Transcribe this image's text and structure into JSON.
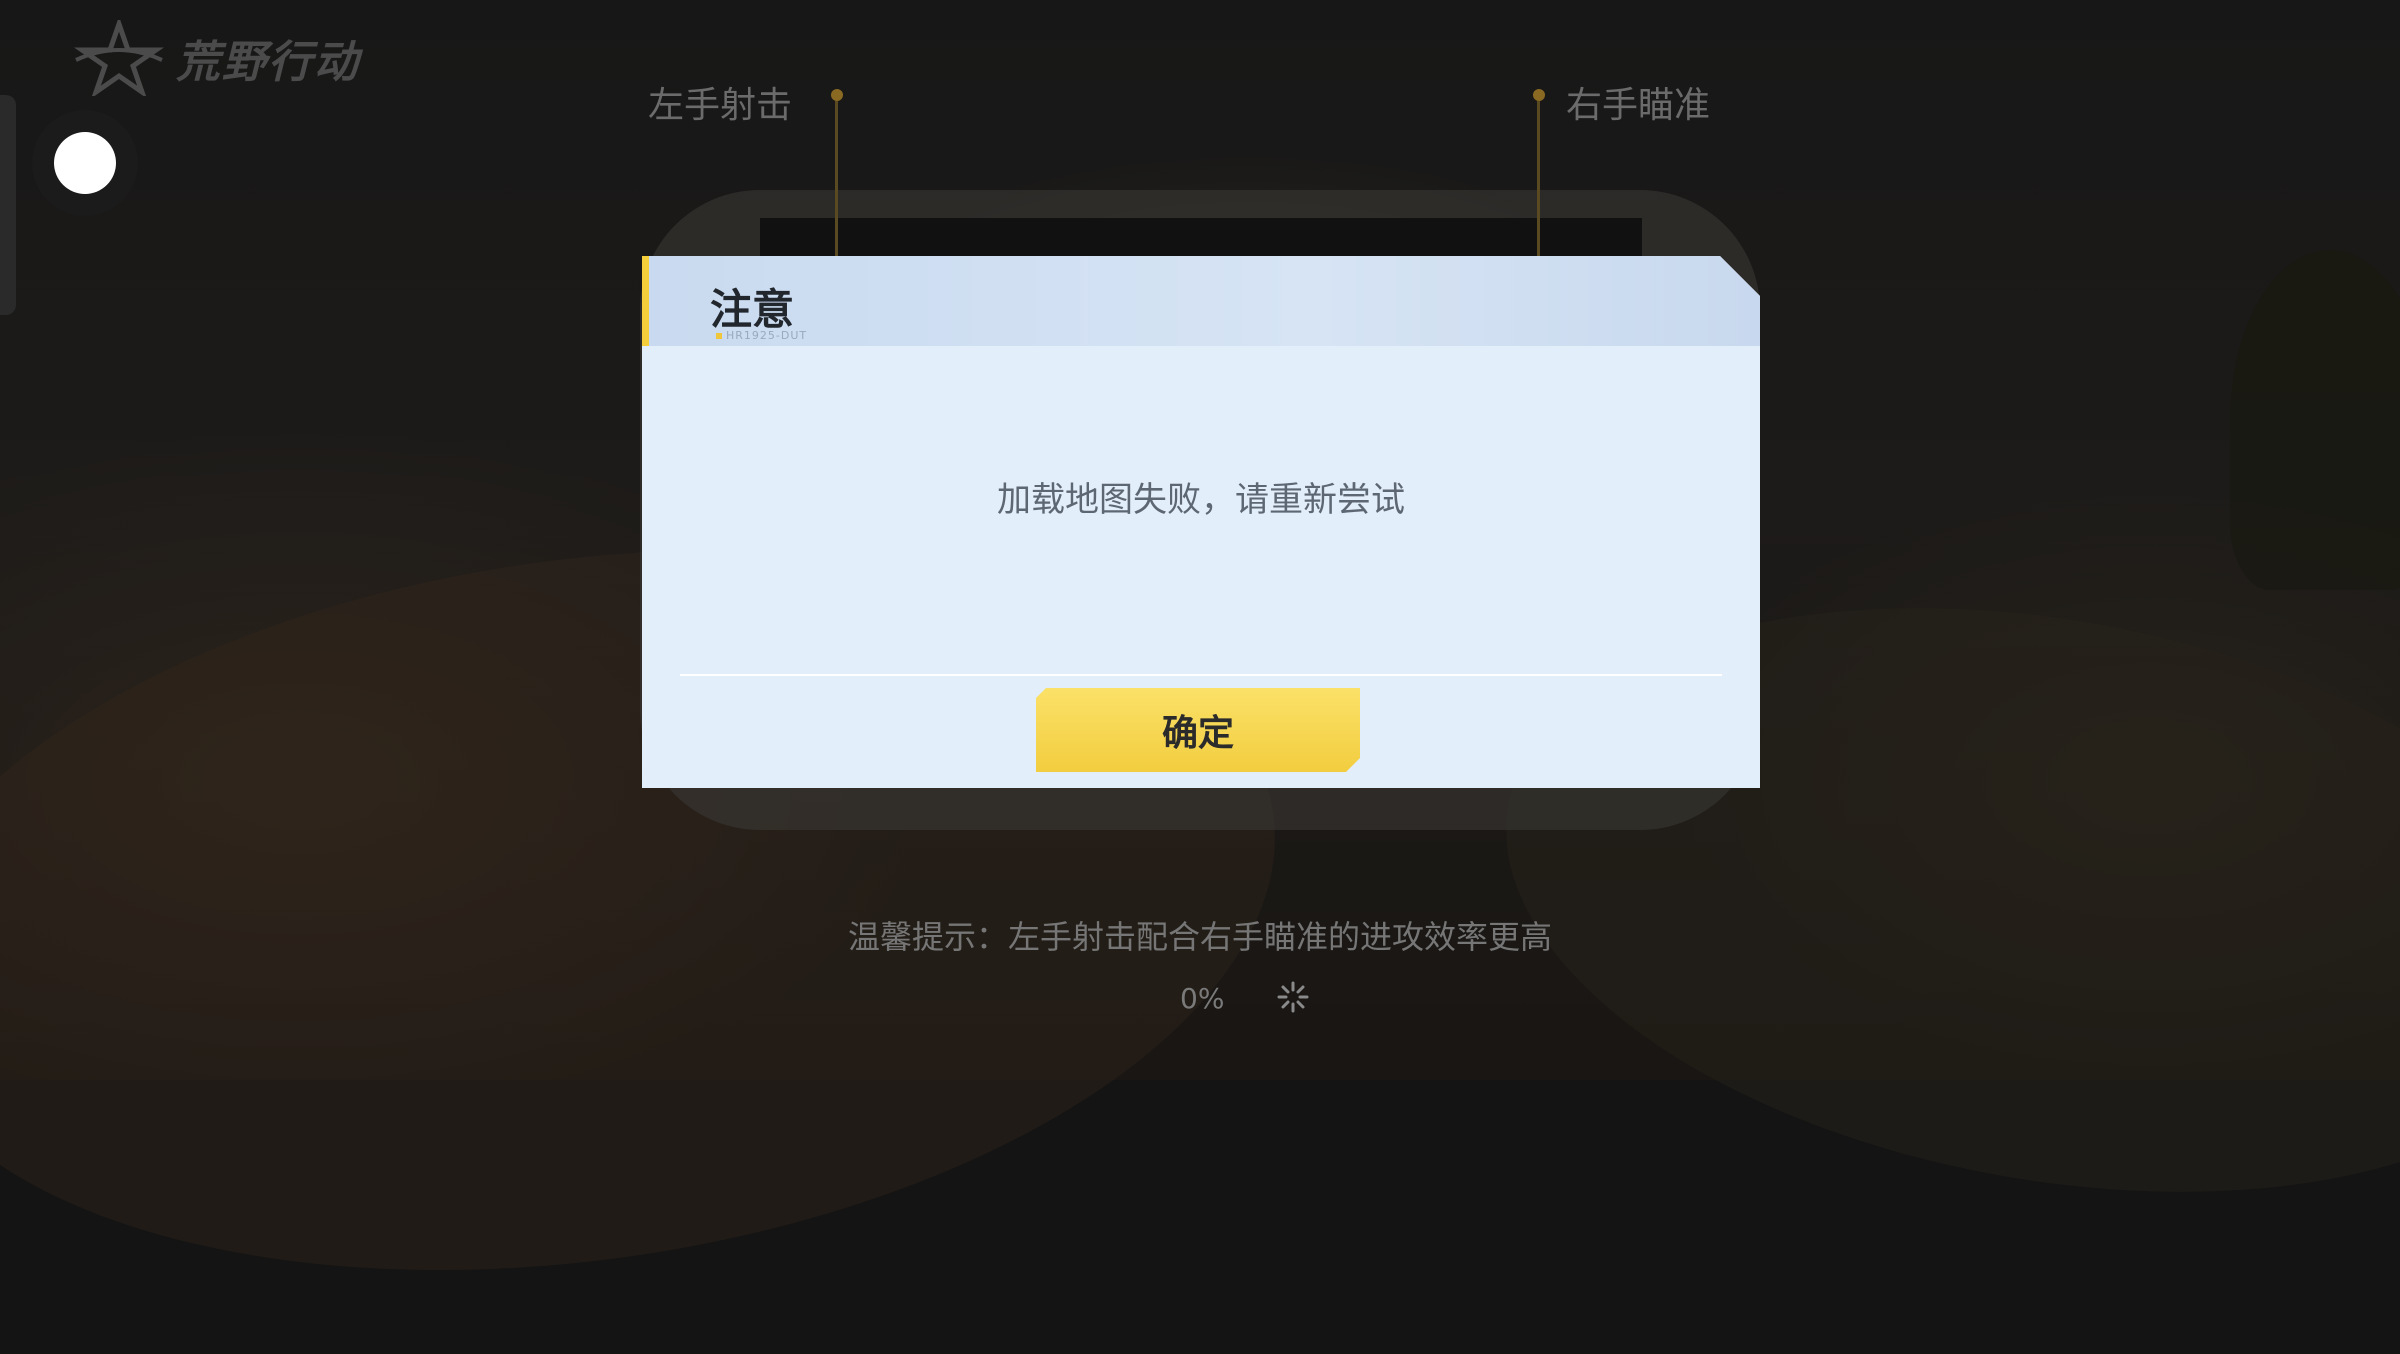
{
  "app": {
    "logo_text": "荒野行动"
  },
  "guide": {
    "left_label": "左手射击",
    "right_label": "右手瞄准"
  },
  "dialog": {
    "title": "注意",
    "subcode": "HR1925-DUT",
    "message": "加载地图失败，请重新尝试",
    "confirm_label": "确定",
    "accent_color": "#f5cf3b",
    "button_color": "#f6d64e"
  },
  "loading": {
    "tip": "温馨提示：左手射击配合右手瞄准的进攻效率更高",
    "progress_text": "0%",
    "progress_value": 0
  },
  "icons": {
    "logo": "star-emblem-icon",
    "floating": "floating-ball-icon",
    "spinner": "loading-spinner-icon"
  }
}
